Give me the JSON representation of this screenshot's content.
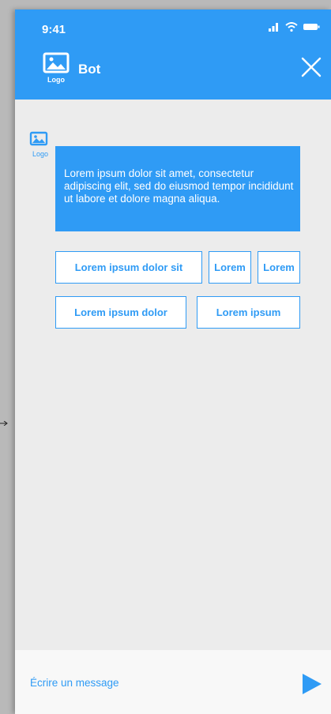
{
  "status_bar": {
    "time": "9:41"
  },
  "header": {
    "logo_label": "Logo",
    "title": "Bot"
  },
  "chat": {
    "bot_logo_label": "Logo",
    "message": "Lorem ipsum dolor sit amet, consectetur adipiscing elit, sed do eiusmod tempor incididunt ut labore et dolore magna aliqua.",
    "choices": [
      "Lorem ipsum dolor sit",
      "Lorem",
      "Lorem",
      "Lorem ipsum dolor",
      "Lorem ipsum"
    ]
  },
  "composer": {
    "placeholder": "Écrire un message"
  },
  "colors": {
    "accent": "#2f9bf5",
    "background": "#ececec",
    "composer": "#f8f8f8"
  },
  "icons": [
    "signal-icon",
    "wifi-icon",
    "battery-icon",
    "image-logo-icon",
    "close-icon",
    "send-icon"
  ]
}
